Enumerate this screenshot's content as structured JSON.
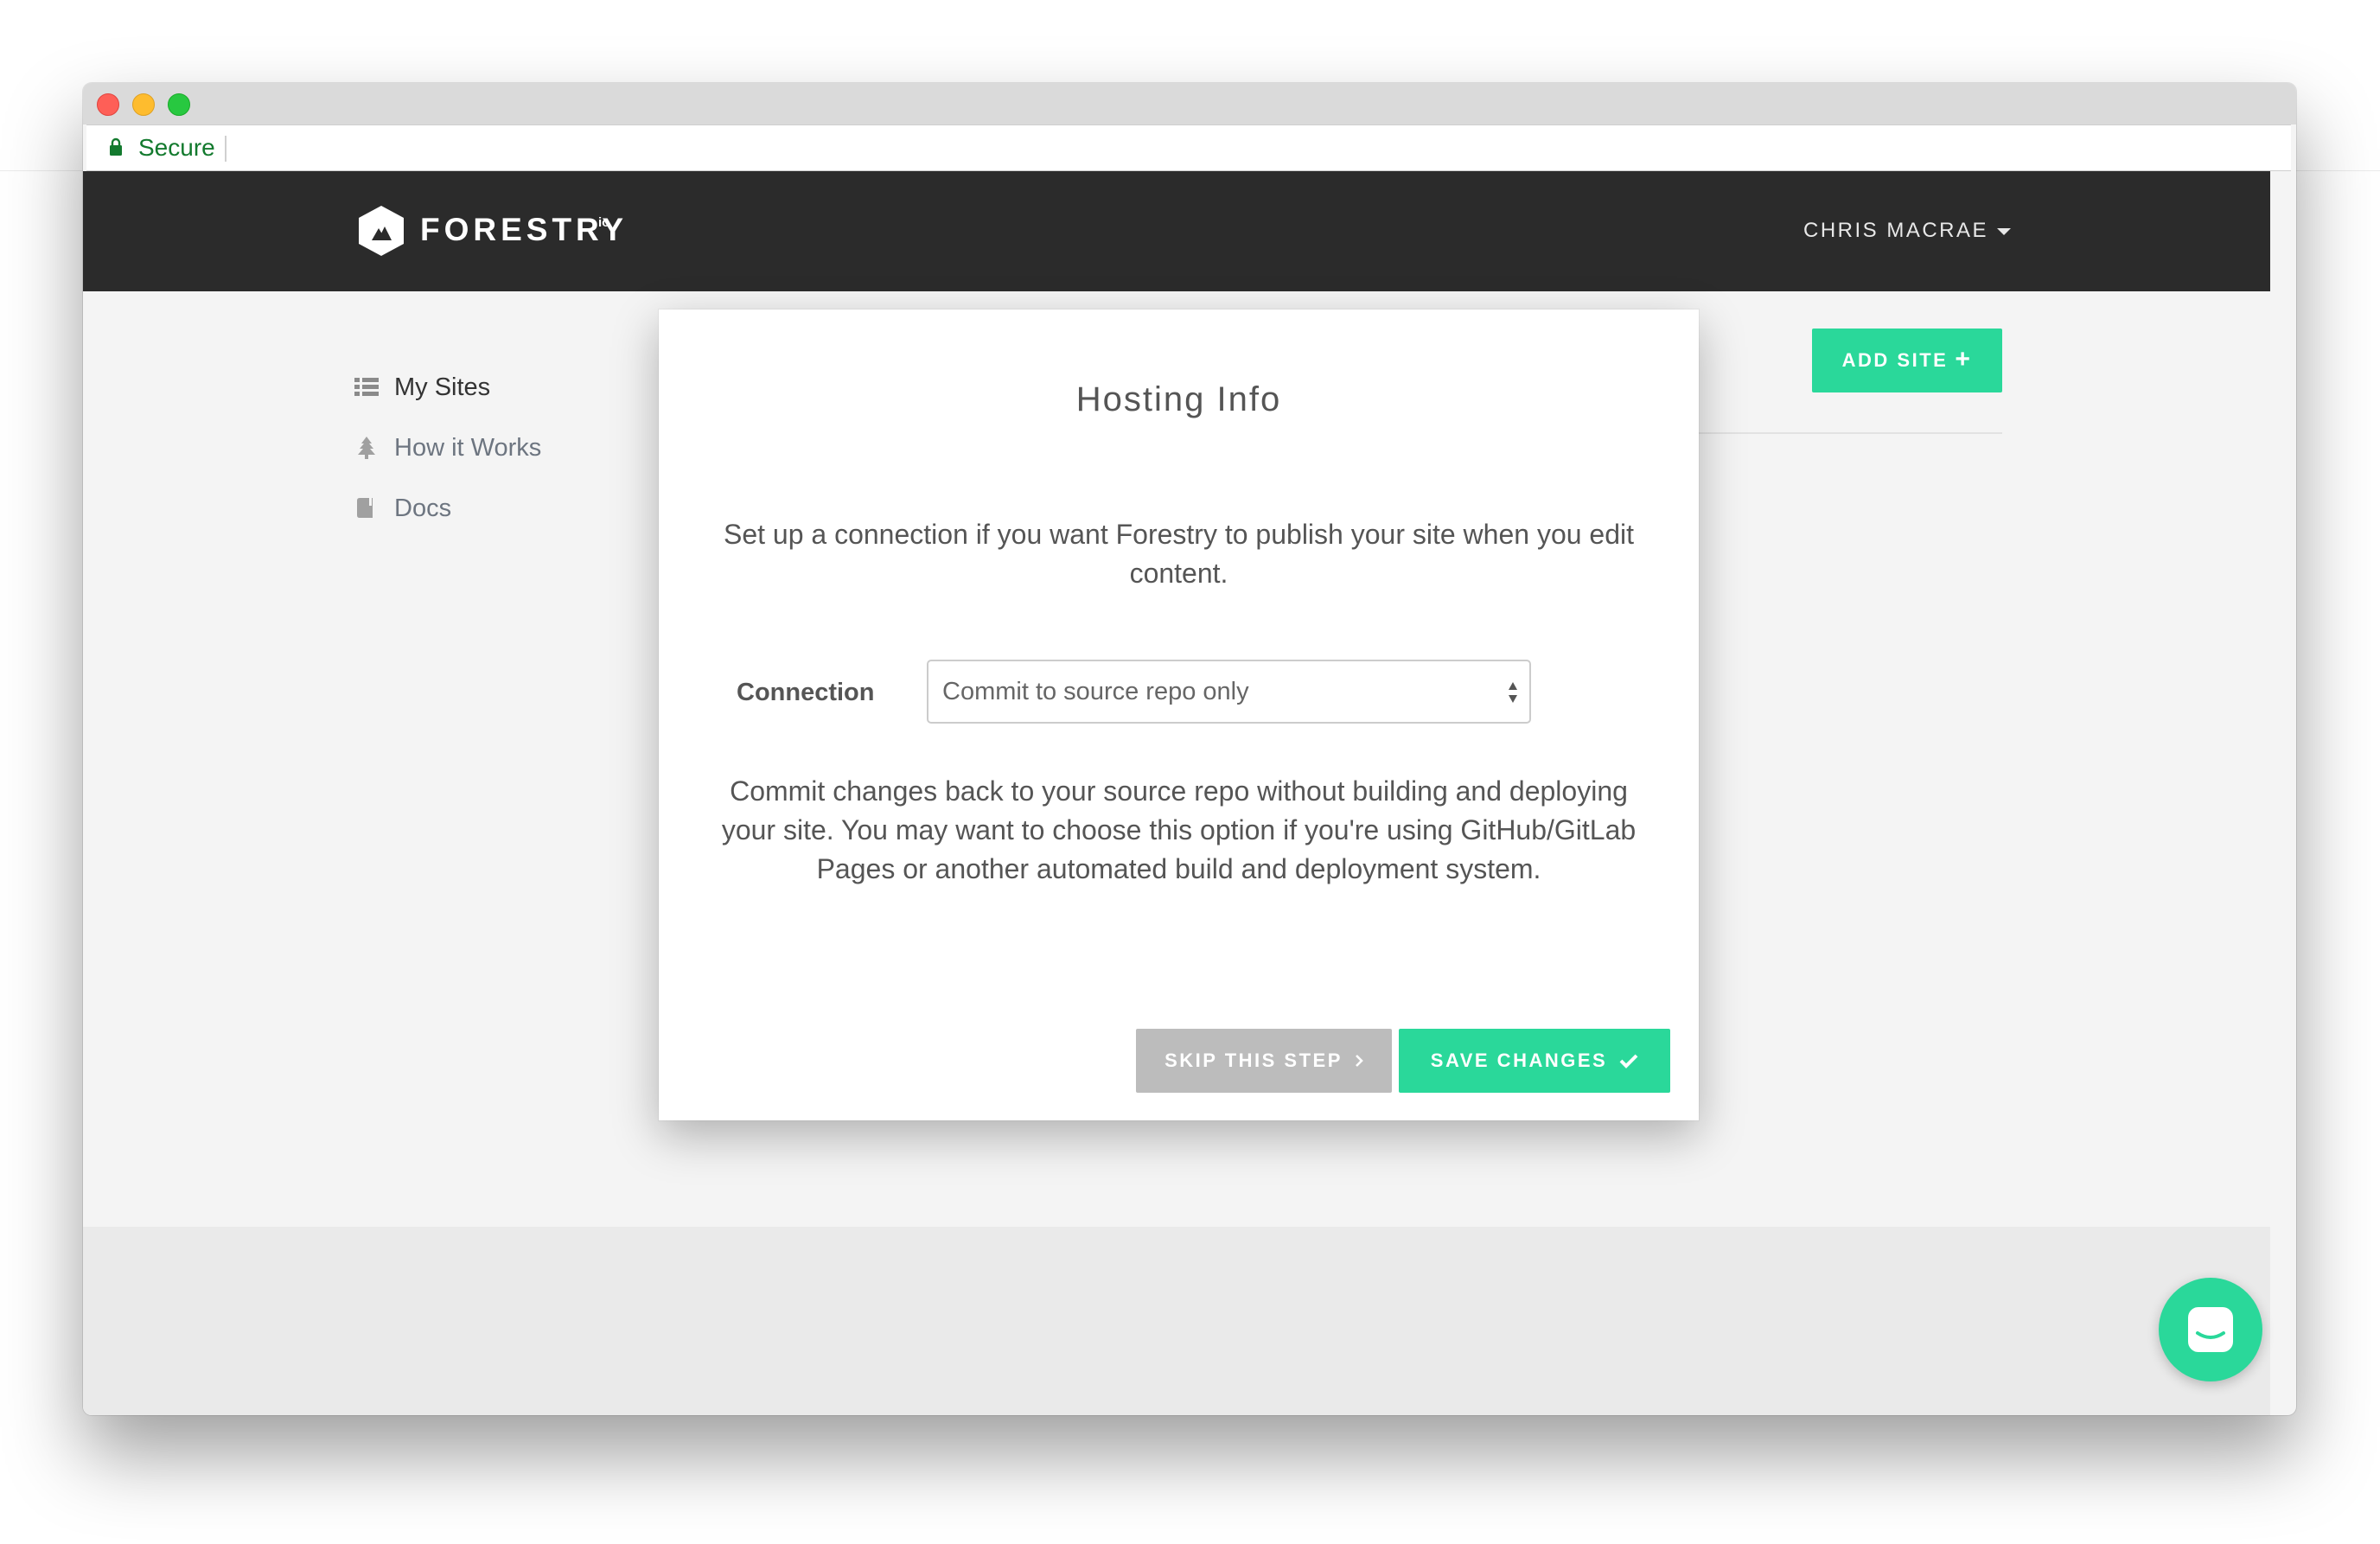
{
  "browser": {
    "secure_label": "Secure"
  },
  "topnav": {
    "logo_text": "FORESTRY",
    "logo_superscript": "io",
    "user_name": "CHRIS MACRAE"
  },
  "sidebar": {
    "items": [
      {
        "label": "My Sites",
        "icon": "list-icon",
        "active": true
      },
      {
        "label": "How it Works",
        "icon": "tree-icon",
        "active": false
      },
      {
        "label": "Docs",
        "icon": "book-icon",
        "active": false
      }
    ]
  },
  "actions": {
    "add_site_label": "ADD SITE"
  },
  "modal": {
    "title": "Hosting Info",
    "intro": "Set up a connection if you want Forestry to publish your site when you edit content.",
    "connection_label": "Connection",
    "connection_value": "Commit to source repo only",
    "description": "Commit changes back to your source repo without building and deploying your site. You may want to choose this option if you're using GitHub/GitLab Pages or another automated build and deployment system.",
    "skip_label": "SKIP THIS STEP",
    "save_label": "SAVE CHANGES"
  },
  "colors": {
    "accent": "#2ad89a",
    "nav_bg": "#2b2b2b",
    "skip_bg": "#bcbcbc",
    "secure_green": "#137a2e"
  }
}
